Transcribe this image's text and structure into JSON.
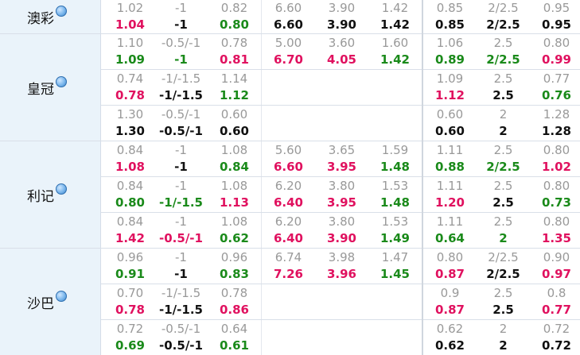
{
  "companies": [
    {
      "name": "澳彩",
      "rows": [
        {
          "a": {
            "top": [
              "1.02",
              "-1",
              "0.82"
            ],
            "bot": [
              "1.04",
              "-1",
              "0.80"
            ],
            "col": [
              "r",
              "k",
              "g"
            ]
          },
          "b": {
            "top": [
              "6.60",
              "3.90",
              "1.42"
            ],
            "bot": [
              "6.60",
              "3.90",
              "1.42"
            ],
            "col": [
              "k",
              "k",
              "k"
            ]
          },
          "c": {
            "top": [
              "0.85",
              "2/2.5",
              "0.95"
            ],
            "bot": [
              "0.85",
              "2/2.5",
              "0.95"
            ],
            "col": [
              "k",
              "k",
              "k"
            ]
          }
        }
      ]
    },
    {
      "name": "皇冠",
      "rows": [
        {
          "a": {
            "top": [
              "1.10",
              "-0.5/-1",
              "0.78"
            ],
            "bot": [
              "1.09",
              "-1",
              "0.81"
            ],
            "col": [
              "g",
              "g",
              "r"
            ]
          },
          "b": {
            "top": [
              "5.00",
              "3.60",
              "1.60"
            ],
            "bot": [
              "6.70",
              "4.05",
              "1.42"
            ],
            "col": [
              "r",
              "r",
              "g"
            ]
          },
          "c": {
            "top": [
              "1.06",
              "2.5",
              "0.80"
            ],
            "bot": [
              "0.89",
              "2/2.5",
              "0.99"
            ],
            "col": [
              "g",
              "g",
              "r"
            ]
          }
        },
        {
          "a": {
            "top": [
              "0.74",
              "-1/-1.5",
              "1.14"
            ],
            "bot": [
              "0.78",
              "-1/-1.5",
              "1.12"
            ],
            "col": [
              "r",
              "k",
              "g"
            ]
          },
          "b": null,
          "c": {
            "top": [
              "1.09",
              "2.5",
              "0.77"
            ],
            "bot": [
              "1.12",
              "2.5",
              "0.76"
            ],
            "col": [
              "r",
              "k",
              "g"
            ]
          }
        },
        {
          "a": {
            "top": [
              "1.30",
              "-0.5/-1",
              "0.60"
            ],
            "bot": [
              "1.30",
              "-0.5/-1",
              "0.60"
            ],
            "col": [
              "k",
              "k",
              "k"
            ]
          },
          "b": null,
          "c": {
            "top": [
              "0.60",
              "2",
              "1.28"
            ],
            "bot": [
              "0.60",
              "2",
              "1.28"
            ],
            "col": [
              "k",
              "k",
              "k"
            ]
          }
        }
      ]
    },
    {
      "name": "利记",
      "rows": [
        {
          "a": {
            "top": [
              "0.84",
              "-1",
              "1.08"
            ],
            "bot": [
              "1.08",
              "-1",
              "0.84"
            ],
            "col": [
              "r",
              "k",
              "g"
            ]
          },
          "b": {
            "top": [
              "5.60",
              "3.65",
              "1.59"
            ],
            "bot": [
              "6.60",
              "3.95",
              "1.48"
            ],
            "col": [
              "r",
              "r",
              "g"
            ]
          },
          "c": {
            "top": [
              "1.11",
              "2.5",
              "0.80"
            ],
            "bot": [
              "0.88",
              "2/2.5",
              "1.02"
            ],
            "col": [
              "g",
              "g",
              "r"
            ]
          }
        },
        {
          "a": {
            "top": [
              "0.84",
              "-1",
              "1.08"
            ],
            "bot": [
              "0.80",
              "-1/-1.5",
              "1.13"
            ],
            "col": [
              "g",
              "g",
              "r"
            ]
          },
          "b": {
            "top": [
              "6.20",
              "3.80",
              "1.53"
            ],
            "bot": [
              "6.40",
              "3.95",
              "1.48"
            ],
            "col": [
              "r",
              "r",
              "g"
            ]
          },
          "c": {
            "top": [
              "1.11",
              "2.5",
              "0.80"
            ],
            "bot": [
              "1.20",
              "2.5",
              "0.73"
            ],
            "col": [
              "r",
              "k",
              "g"
            ]
          }
        },
        {
          "a": {
            "top": [
              "0.84",
              "-1",
              "1.08"
            ],
            "bot": [
              "1.42",
              "-0.5/-1",
              "0.62"
            ],
            "col": [
              "r",
              "r",
              "g"
            ]
          },
          "b": {
            "top": [
              "6.20",
              "3.80",
              "1.53"
            ],
            "bot": [
              "6.40",
              "3.90",
              "1.49"
            ],
            "col": [
              "r",
              "r",
              "g"
            ]
          },
          "c": {
            "top": [
              "1.11",
              "2.5",
              "0.80"
            ],
            "bot": [
              "0.64",
              "2",
              "1.35"
            ],
            "col": [
              "g",
              "g",
              "r"
            ]
          }
        }
      ]
    },
    {
      "name": "沙巴",
      "rows": [
        {
          "a": {
            "top": [
              "0.96",
              "-1",
              "0.96"
            ],
            "bot": [
              "0.91",
              "-1",
              "0.83"
            ],
            "col": [
              "g",
              "k",
              "g"
            ]
          },
          "b": {
            "top": [
              "6.74",
              "3.98",
              "1.47"
            ],
            "bot": [
              "7.26",
              "3.96",
              "1.45"
            ],
            "col": [
              "r",
              "r",
              "g"
            ]
          },
          "c": {
            "top": [
              "0.80",
              "2/2.5",
              "0.90"
            ],
            "bot": [
              "0.87",
              "2/2.5",
              "0.97"
            ],
            "col": [
              "r",
              "k",
              "r"
            ]
          }
        },
        {
          "a": {
            "top": [
              "0.70",
              "-1/-1.5",
              "0.78"
            ],
            "bot": [
              "0.78",
              "-1/-1.5",
              "0.86"
            ],
            "col": [
              "r",
              "k",
              "r"
            ]
          },
          "b": null,
          "c": {
            "top": [
              "0.9",
              "2.5",
              "0.8"
            ],
            "bot": [
              "0.87",
              "2.5",
              "0.77"
            ],
            "col": [
              "r",
              "k",
              "r"
            ]
          }
        },
        {
          "a": {
            "top": [
              "0.72",
              "-0.5/-1",
              "0.64"
            ],
            "bot": [
              "0.69",
              "-0.5/-1",
              "0.61"
            ],
            "col": [
              "g",
              "k",
              "g"
            ]
          },
          "b": null,
          "c": {
            "top": [
              "0.62",
              "2",
              "0.72"
            ],
            "bot": [
              "0.62",
              "2",
              "0.72"
            ],
            "col": [
              "k",
              "k",
              "k"
            ]
          }
        }
      ]
    }
  ]
}
